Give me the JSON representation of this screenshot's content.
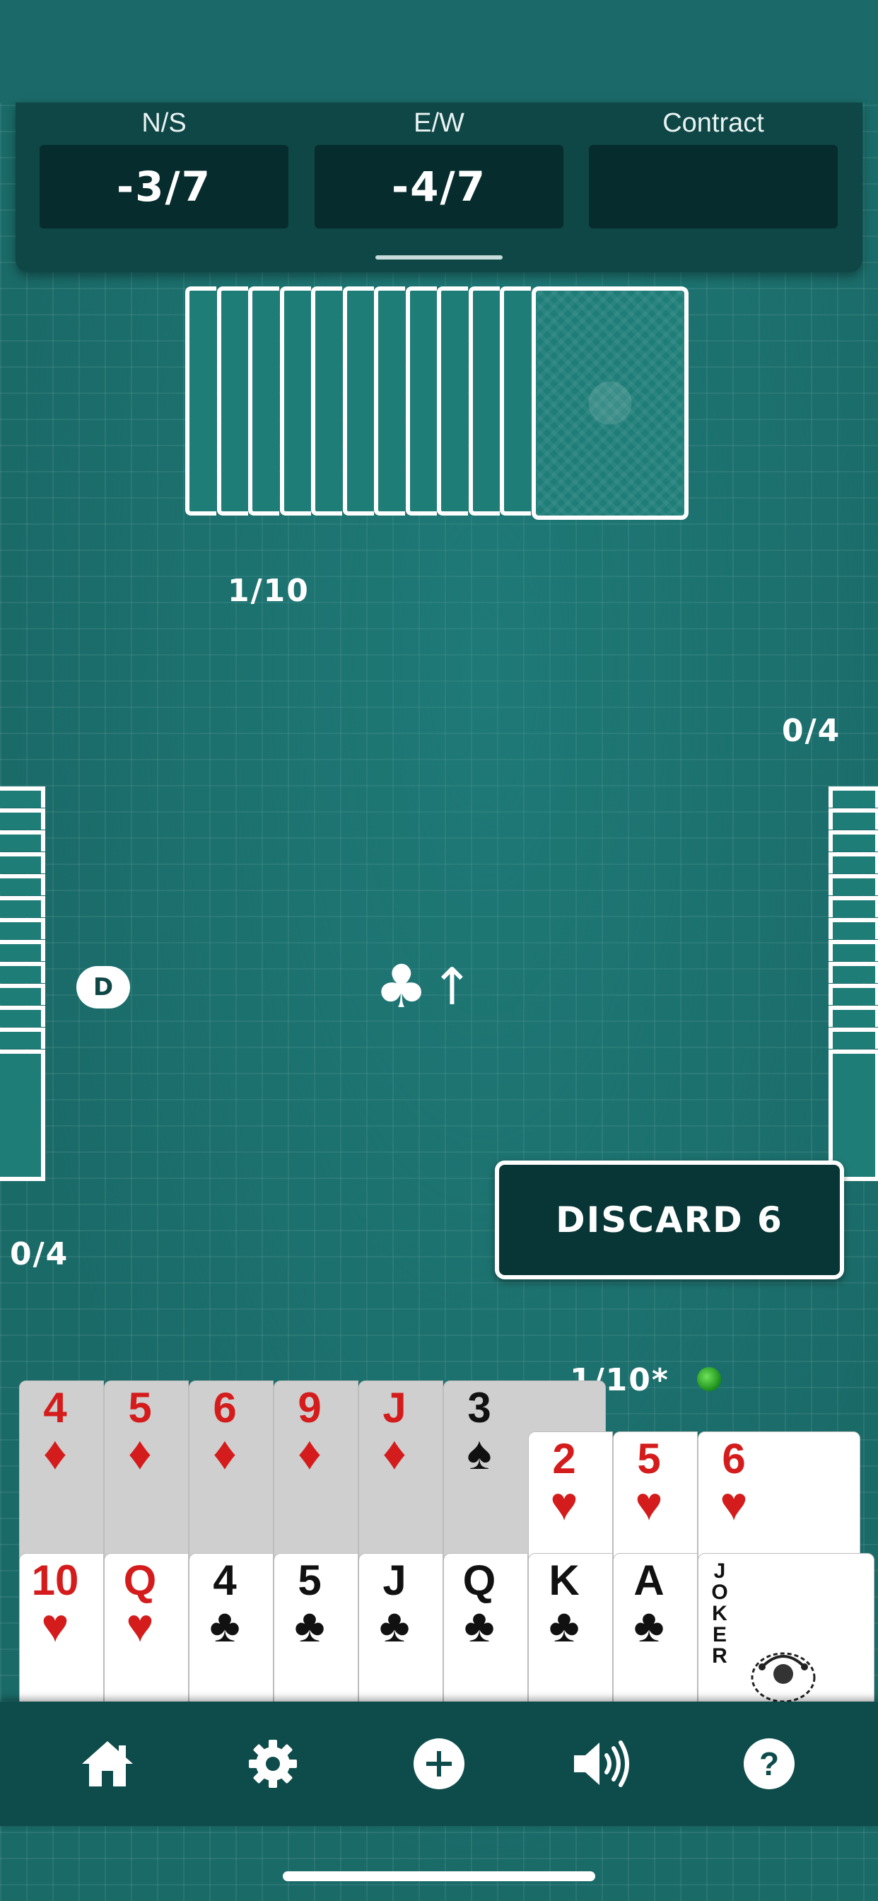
{
  "score_panel": {
    "ns_label": "N/S",
    "ns_value": "-3/7",
    "ew_label": "E/W",
    "ew_value": "-4/7",
    "contract_label": "Contract",
    "contract_value": ""
  },
  "tricks": {
    "north": "1/10",
    "east": "0/4",
    "west": "0/4",
    "south": "1/10*"
  },
  "dealer_chip": "D",
  "lead_suit": "♣",
  "lead_arrow": "↑",
  "discard_button": "DISCARD 6",
  "hand": {
    "selected_row": [
      {
        "rank": "4",
        "suit": "♦"
      },
      {
        "rank": "5",
        "suit": "♦"
      },
      {
        "rank": "6",
        "suit": "♦"
      },
      {
        "rank": "9",
        "suit": "♦"
      },
      {
        "rank": "J",
        "suit": "♦"
      },
      {
        "rank": "3",
        "suit": "♠"
      }
    ],
    "middle_row": [
      {
        "rank": "2",
        "suit": "♥"
      },
      {
        "rank": "5",
        "suit": "♥"
      },
      {
        "rank": "6",
        "suit": "♥"
      }
    ],
    "bottom_row": [
      {
        "rank": "10",
        "suit": "♥"
      },
      {
        "rank": "Q",
        "suit": "♥"
      },
      {
        "rank": "4",
        "suit": "♣"
      },
      {
        "rank": "5",
        "suit": "♣"
      },
      {
        "rank": "J",
        "suit": "♣"
      },
      {
        "rank": "Q",
        "suit": "♣"
      },
      {
        "rank": "K",
        "suit": "♣"
      },
      {
        "rank": "A",
        "suit": "♣"
      }
    ],
    "joker_text": "JOKER"
  },
  "nav": [
    "home-icon",
    "gear-icon",
    "plus-circle-icon",
    "speaker-icon",
    "help-icon"
  ],
  "colors": {
    "table": "#1a6a68",
    "panel": "#0f4646",
    "red_suit": "#d41c1c"
  }
}
